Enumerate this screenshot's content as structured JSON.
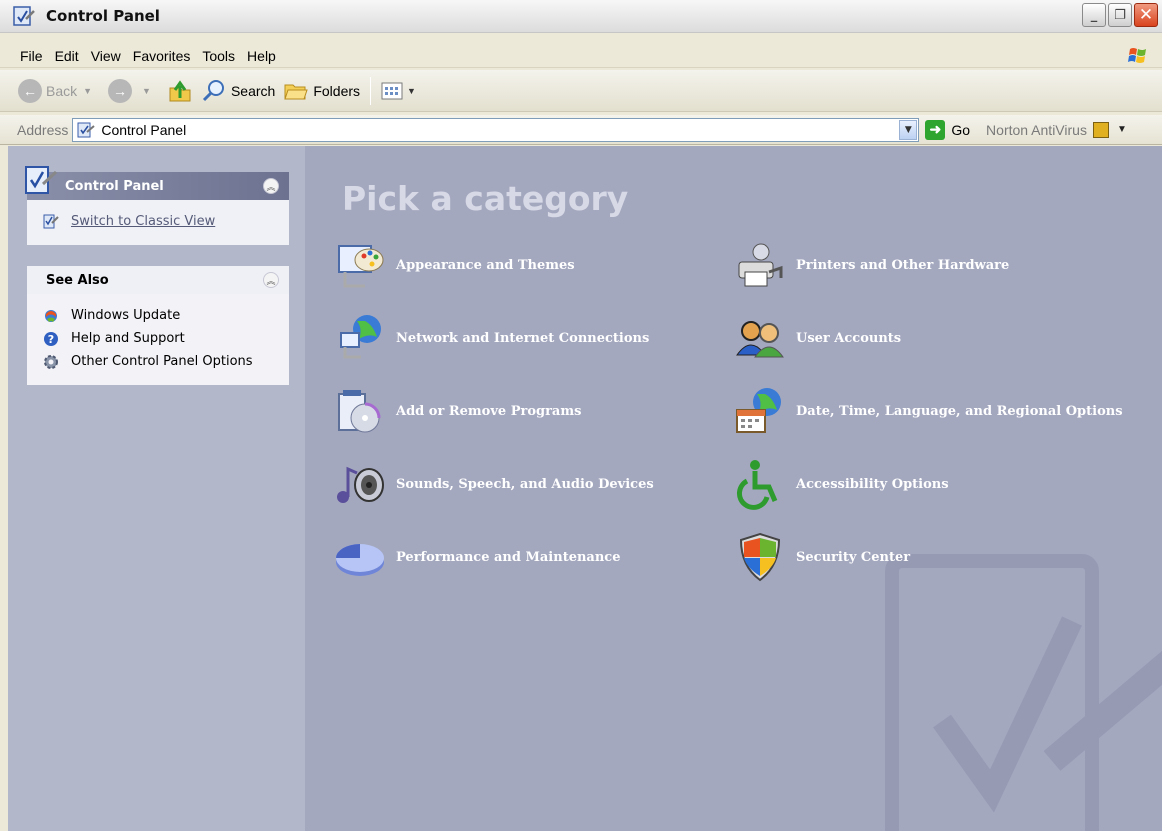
{
  "window": {
    "title": "Control Panel"
  },
  "menu": [
    "File",
    "Edit",
    "View",
    "Favorites",
    "Tools",
    "Help"
  ],
  "toolbar": {
    "back": "Back",
    "search": "Search",
    "folders": "Folders"
  },
  "address": {
    "label": "Address",
    "value": "Control Panel",
    "go": "Go",
    "norton": "Norton AntiVirus"
  },
  "sidebar": {
    "control_panel": {
      "title": "Control Panel",
      "link": "Switch to Classic View"
    },
    "see_also": {
      "title": "See Also",
      "items": [
        "Windows Update",
        "Help and Support",
        "Other Control Panel Options"
      ]
    }
  },
  "main": {
    "heading": "Pick a category",
    "categories": [
      "Appearance and Themes",
      "Printers and Other Hardware",
      "Network and Internet Connections",
      "User Accounts",
      "Add or Remove Programs",
      "Date, Time, Language, and Regional Options",
      "Sounds, Speech, and Audio Devices",
      "Accessibility Options",
      "Performance and Maintenance",
      "Security Center"
    ]
  },
  "colors": {
    "content_bg": "#a4a8bf",
    "sidebar_bg": "#b2b7ca",
    "heading": "#d7d9e6",
    "category_text": "#ffffff"
  }
}
